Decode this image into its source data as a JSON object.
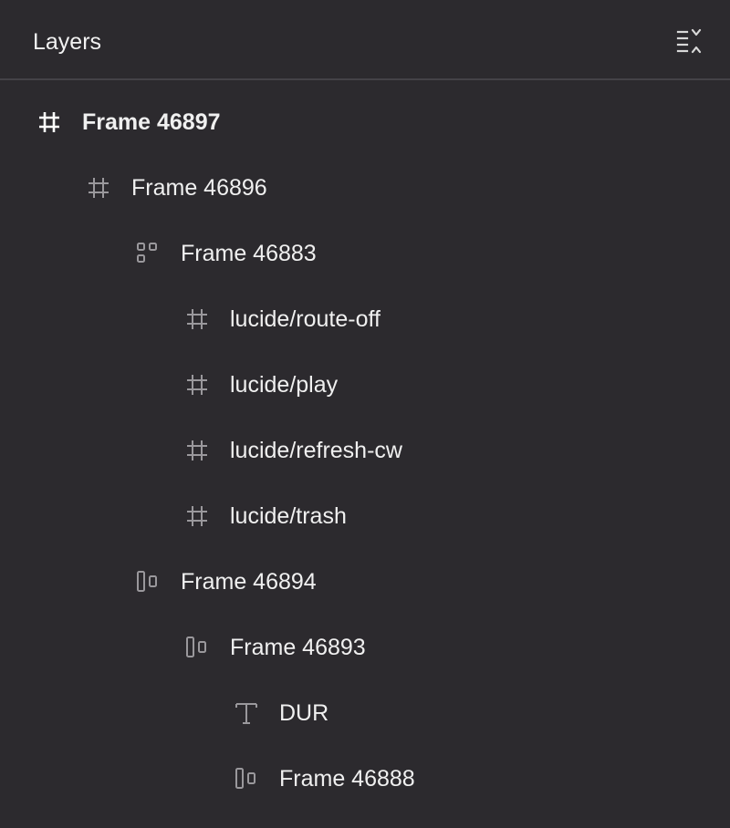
{
  "header": {
    "title": "Layers",
    "collapse_icon": "collapse-all-icon"
  },
  "layers": [
    {
      "name": "Frame 46897",
      "depth": 0,
      "icon": "frame-icon"
    },
    {
      "name": "Frame 46896",
      "depth": 1,
      "icon": "frame-icon"
    },
    {
      "name": "Frame 46883",
      "depth": 2,
      "icon": "grid-layout-icon"
    },
    {
      "name": "lucide/route-off",
      "depth": 3,
      "icon": "frame-icon"
    },
    {
      "name": "lucide/play",
      "depth": 3,
      "icon": "frame-icon"
    },
    {
      "name": "lucide/refresh-cw",
      "depth": 3,
      "icon": "frame-icon"
    },
    {
      "name": "lucide/trash",
      "depth": 3,
      "icon": "frame-icon"
    },
    {
      "name": "Frame 46894",
      "depth": 2,
      "icon": "horizontal-layout-icon"
    },
    {
      "name": "Frame 46893",
      "depth": 3,
      "icon": "horizontal-layout-icon"
    },
    {
      "name": "DUR",
      "depth": 4,
      "icon": "text-icon"
    },
    {
      "name": "Frame 46888",
      "depth": 4,
      "icon": "horizontal-layout-icon"
    }
  ]
}
